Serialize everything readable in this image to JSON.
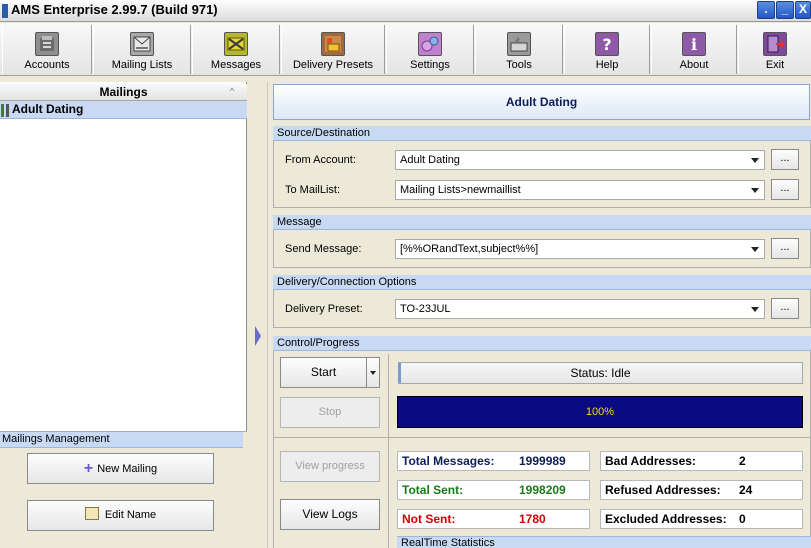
{
  "window": {
    "title": "AMS Enterprise 2.99.7 (Build 971)",
    "min_label": ".",
    "max_label": "_",
    "close_label": "X"
  },
  "toolbar": {
    "items": [
      {
        "label": "Accounts",
        "icon": "accounts-icon"
      },
      {
        "label": "Mailing Lists",
        "icon": "mailing-lists-icon"
      },
      {
        "label": "Messages",
        "icon": "messages-icon"
      },
      {
        "label": "Delivery Presets",
        "icon": "delivery-presets-icon"
      },
      {
        "label": "Settings",
        "icon": "settings-icon"
      },
      {
        "label": "Tools",
        "icon": "tools-icon"
      },
      {
        "label": "Help",
        "icon": "help-icon"
      },
      {
        "label": "About",
        "icon": "about-icon"
      },
      {
        "label": "Exit",
        "icon": "exit-icon"
      }
    ]
  },
  "mailings": {
    "header": "Mailings",
    "sort_glyph": "^",
    "items": [
      "Adult Dating"
    ],
    "management_header": "Mailings Management",
    "new_button": "New Mailing",
    "edit_button": "Edit Name"
  },
  "detail": {
    "title": "Adult Dating",
    "source": {
      "header": "Source/Destination",
      "from_label": "From Account:",
      "from_value": "Adult Dating",
      "to_label": "To MailList:",
      "to_value": "Mailing Lists>newmaillist"
    },
    "message": {
      "header": "Message",
      "send_label": "Send Message:",
      "send_value": "[%%ORandText,subject%%]"
    },
    "delivery": {
      "header": "Delivery/Connection Options",
      "preset_label": "Delivery Preset:",
      "preset_value": "TO-23JUL"
    },
    "dots_label": "...",
    "control": {
      "header": "Control/Progress",
      "start_button": "Start",
      "stop_button": "Stop",
      "view_progress_button": "View progress",
      "view_logs_button": "View Logs",
      "status_text": "Status: Idle",
      "progress_text": "100%",
      "progress_fraction": 1.0
    },
    "stats": {
      "total_messages_label": "Total Messages:",
      "total_messages_value": "1999989",
      "total_sent_label": "Total Sent:",
      "total_sent_value": "1998209",
      "not_sent_label": "Not Sent:",
      "not_sent_value": "1780",
      "bad_label": "Bad Addresses:",
      "bad_value": "2",
      "refused_label": "Refused Addresses:",
      "refused_value": "24",
      "excluded_label": "Excluded Addresses:",
      "excluded_value": "0",
      "realtime_header": "RealTime Statistics"
    }
  },
  "colors": {
    "accent_header": "#c8daf3",
    "progress_bar": "#0a0a82",
    "progress_text": "#ffd700",
    "total_messages": "#0d1e56",
    "total_sent": "#1a7a1a",
    "not_sent": "#d00000"
  }
}
